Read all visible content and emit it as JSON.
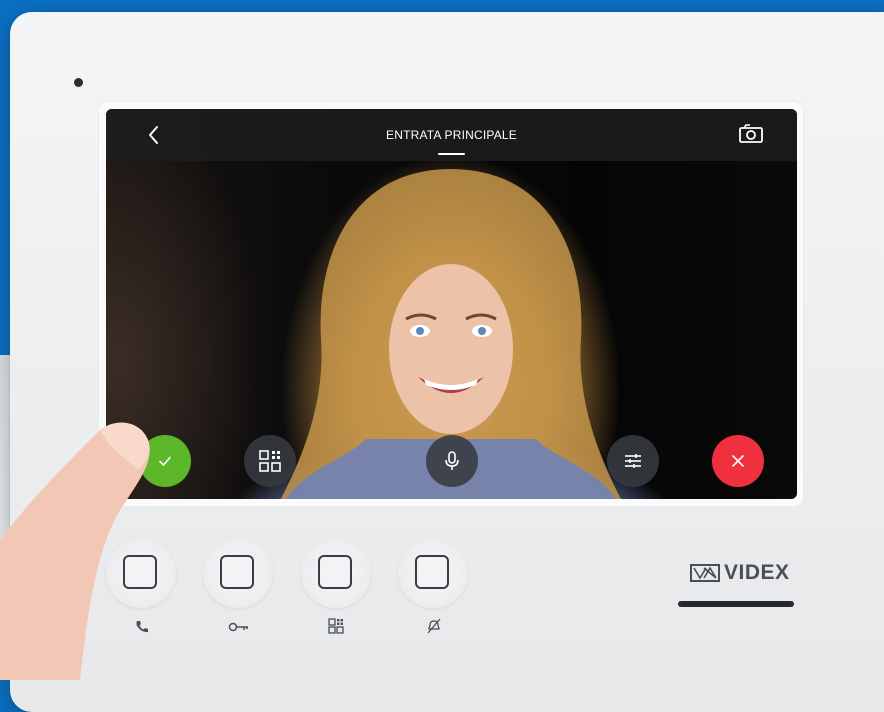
{
  "screen": {
    "title": "ENTRATA PRINCIPALE"
  },
  "icons": {
    "back": "chevron-left-icon",
    "snapshot": "camera-icon",
    "accept": "check-icon",
    "qr": "qr-grid-icon",
    "mic": "microphone-icon",
    "settings": "sliders-icon",
    "reject": "close-icon",
    "hw_call": "phone-icon",
    "hw_key": "key-icon",
    "hw_grid": "qr-grid-icon",
    "hw_mute": "mute-icon"
  },
  "colors": {
    "accept": "#5cb82a",
    "reject": "#f0303f",
    "background": "#0b6fc1"
  },
  "brand": {
    "name": "VIDEX"
  }
}
